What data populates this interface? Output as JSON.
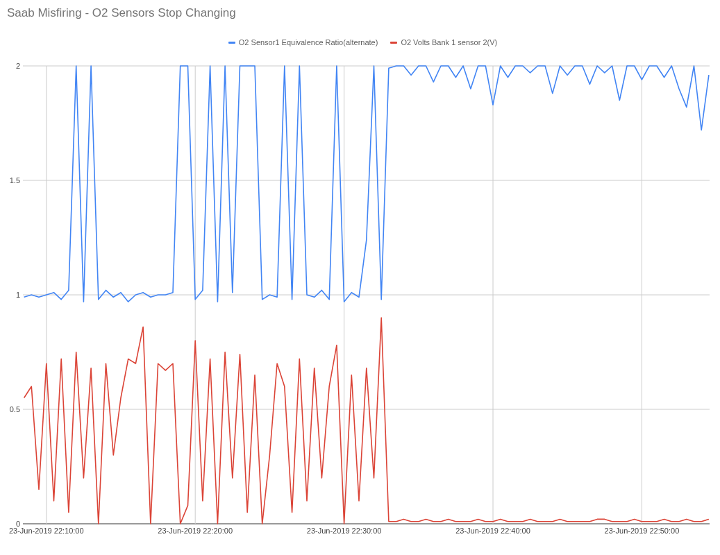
{
  "title": "Saab Misfiring - O2 Sensors Stop Changing",
  "chart_data": {
    "type": "line",
    "categories": [
      null,
      null,
      null,
      "23-Jun-2019 22:10:00",
      null,
      null,
      null,
      null,
      null,
      null,
      null,
      null,
      null,
      null,
      null,
      null,
      null,
      null,
      null,
      null,
      null,
      null,
      null,
      "23-Jun-2019 22:20:00",
      null,
      null,
      null,
      null,
      null,
      null,
      null,
      null,
      null,
      null,
      null,
      null,
      null,
      null,
      null,
      null,
      null,
      null,
      null,
      "23-Jun-2019 22:30:00",
      null,
      null,
      null,
      null,
      null,
      null,
      null,
      null,
      null,
      null,
      null,
      null,
      null,
      null,
      null,
      null,
      null,
      null,
      null,
      "23-Jun-2019 22:40:00",
      null,
      null,
      null,
      null,
      null,
      null,
      null,
      null,
      null,
      null,
      null,
      null,
      null,
      null,
      null,
      null,
      null,
      null,
      null,
      "23-Jun-2019 22:50:00",
      null,
      null,
      null,
      null,
      null,
      null,
      null,
      null,
      null
    ],
    "series": [
      {
        "name": "O2 Sensor1 Equivalence Ratio(alternate)",
        "color": "#4285f4",
        "values": [
          0.99,
          1.0,
          0.99,
          1.0,
          1.01,
          0.98,
          1.02,
          2,
          0.97,
          2,
          0.98,
          1.02,
          0.99,
          1.01,
          0.97,
          1.0,
          1.01,
          0.99,
          1.0,
          1.0,
          1.01,
          2,
          2,
          0.98,
          1.02,
          2,
          0.97,
          2,
          1.01,
          2,
          2,
          2,
          0.98,
          1.0,
          0.99,
          2,
          0.98,
          2,
          1.0,
          0.99,
          1.02,
          0.98,
          2,
          0.97,
          1.01,
          0.99,
          1.24,
          2,
          0.98,
          1.99,
          2,
          2,
          1.96,
          2,
          2,
          1.93,
          2,
          2,
          1.95,
          2,
          1.9,
          2,
          2,
          1.83,
          2,
          1.95,
          2,
          2,
          1.97,
          2,
          2,
          1.88,
          2,
          1.96,
          2,
          2,
          1.92,
          2,
          1.97,
          2,
          1.85,
          2,
          2,
          1.94,
          2,
          2,
          1.95,
          2,
          1.9,
          1.82,
          2,
          1.72,
          1.96
        ]
      },
      {
        "name": "O2 Volts Bank 1 sensor 2(V)",
        "color": "#db4437",
        "values": [
          0.55,
          0.6,
          0.15,
          0.7,
          0.1,
          0.72,
          0.05,
          0.75,
          0.2,
          0.68,
          0.0,
          0.7,
          0.3,
          0.55,
          0.72,
          0.7,
          0.86,
          0.0,
          0.7,
          0.67,
          0.7,
          0.0,
          0.08,
          0.8,
          0.1,
          0.72,
          0.0,
          0.75,
          0.2,
          0.74,
          0.05,
          0.65,
          0.0,
          0.3,
          0.7,
          0.6,
          0.05,
          0.72,
          0.1,
          0.68,
          0.2,
          0.6,
          0.78,
          0.0,
          0.65,
          0.1,
          0.68,
          0.2,
          0.9,
          0.01,
          0.01,
          0.02,
          0.01,
          0.01,
          0.02,
          0.01,
          0.01,
          0.02,
          0.01,
          0.01,
          0.01,
          0.02,
          0.01,
          0.01,
          0.02,
          0.01,
          0.01,
          0.01,
          0.02,
          0.01,
          0.01,
          0.01,
          0.02,
          0.01,
          0.01,
          0.01,
          0.01,
          0.02,
          0.02,
          0.01,
          0.01,
          0.01,
          0.02,
          0.01,
          0.01,
          0.01,
          0.02,
          0.01,
          0.01,
          0.02,
          0.01,
          0.01,
          0.02
        ]
      }
    ],
    "ylim": [
      0,
      2
    ],
    "grid": true,
    "yticks": [
      0,
      0.5,
      1,
      1.5,
      2
    ]
  }
}
